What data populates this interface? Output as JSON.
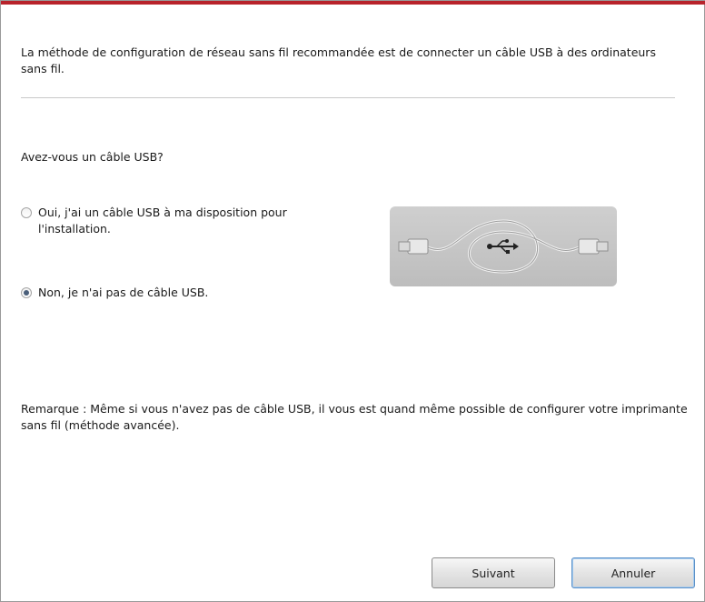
{
  "intro_text": "La méthode de configuration de réseau sans fil recommandée est de connecter un câble USB à des ordinateurs sans fil.",
  "question": "Avez-vous un câble USB?",
  "options": [
    {
      "label": "Oui, j'ai un câble USB à ma disposition pour l'installation.",
      "checked": false
    },
    {
      "label": "Non, je n'ai pas de câble USB.",
      "checked": true
    }
  ],
  "illustration": {
    "icon": "usb-cable-icon"
  },
  "note": "Remarque :  Même si vous n'avez pas de câble USB, il vous est quand même possible de configurer votre imprimante sans fil (méthode avancée).",
  "buttons": {
    "next": "Suivant",
    "cancel": "Annuler"
  },
  "colors": {
    "accent_strip": "#b8232b",
    "default_button_border": "#5a8fc7"
  }
}
